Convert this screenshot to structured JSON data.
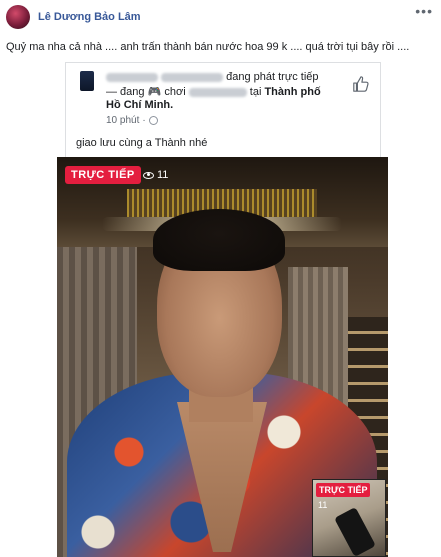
{
  "post": {
    "author": "Lê Dương Bảo Lâm",
    "more_icon": "ellipsis-icon",
    "text": "Quỷ ma nha cả nhà .... anh trấn thành bán nước hoa 99 k .... quá trời tụi bây rồi ...."
  },
  "shared": {
    "status_text": "đang phát trực tiếp",
    "line2_prefix": "— đang",
    "line2_play": "chơi",
    "line2_at": "tại",
    "location_part1": "Thành phố",
    "location_part2": "Hồ Chí Minh.",
    "time": "10 phút",
    "caption": "giao lưu cùng a Thành nhé",
    "like_icon": "thumbs-up-icon"
  },
  "video": {
    "live_label": "TRỰC TIẾP",
    "viewer_count": "11",
    "pip_live_label": "TRỰC TIẾP",
    "pip_count": "11",
    "colors": {
      "live": "#e41e3f"
    }
  }
}
